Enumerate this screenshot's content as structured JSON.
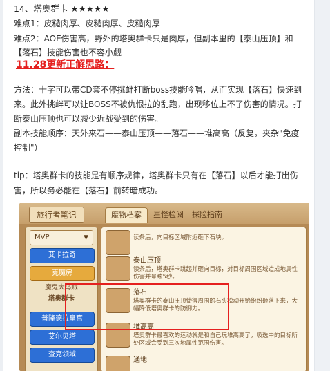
{
  "article": {
    "section_title": "14、塔奥群卡 ★★★★★",
    "difficulty1": "难点1：皮糙肉厚、皮糙肉厚、皮糙肉厚",
    "difficulty2_line1": "难点2：AOE伤害高，野外的塔奥群卡只是肉厚，但副本里的【泰山压顶】和",
    "difficulty2_line2": "【落石】技能伤害也不容小觑",
    "update_heading": "11.28更新正解思路：",
    "method_line1": "方法：十字可以带CD套不停挑衅打断boss技能吟唱，从而实现【落石】快速到",
    "method_line2": "来。此外挑衅可以让BOSS不被仇恨拉的乱跑，出现移位上不了伤害的情况。打",
    "method_line3": "断泰山压顶也可以减少近战受到的伤害。",
    "order_line1": "副本技能顺序：天外来石——泰山压顶——落石——堆高高（反复，夹杂\"免疫",
    "order_line2": "控制\"）",
    "tip_line1": "tip：塔奥群卡的技能是有顺序规律，塔奥群卡只有在【落石】以后才能打出伤",
    "tip_line2": "害，所以务必能在【落石】前转暗成功。"
  },
  "game": {
    "journal_title": "旅行者笔记",
    "tabs": [
      "魔物档案",
      "星怪检阅",
      "探险指南"
    ],
    "dropdown_value": "MVP",
    "locations": [
      {
        "label": "艾卡拉奇"
      },
      {
        "label": "克魔房"
      },
      {
        "label": "普隆德拉皇宫"
      },
      {
        "label": "艾尔贝塔"
      },
      {
        "label": "查克领域"
      }
    ],
    "selected_monster": "魔鬼大乌贼",
    "selected_monster2": "塔奥群卡",
    "skills": [
      {
        "name": "",
        "desc": "读条后，向目标区域附近砸下石块。"
      },
      {
        "name": "泰山压顶",
        "desc": "读条后，塔奥群卡跳起并砸向目标，对目标周围区域造成地属性伤害并晕眩5秒。"
      },
      {
        "name": "落石",
        "desc": "塔奥群卡的泰山压顶使得周围的石头松动开始纷纷砸落下来，大幅降低塔奥群卡的防御力。"
      },
      {
        "name": "堆高高",
        "desc": "塔奥群卡最喜欢的运动就是和自己玩堆高高了，吸选中的目标所处区域会受到三次地属性范围伤害。"
      },
      {
        "name": "通地",
        "desc": ""
      }
    ]
  }
}
